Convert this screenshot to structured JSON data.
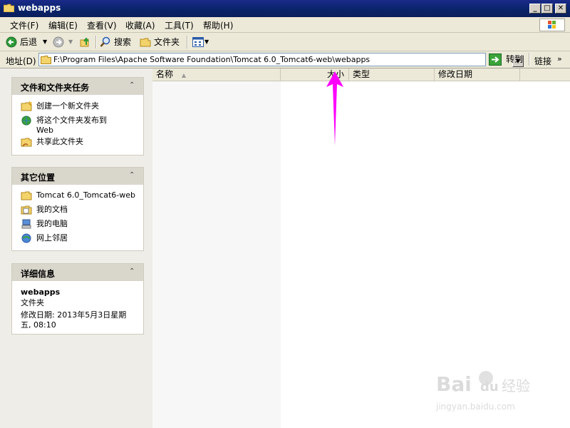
{
  "window": {
    "title": "webapps",
    "min_label": "_",
    "max_label": "□",
    "close_label": "✕"
  },
  "menu": {
    "items": [
      "文件(F)",
      "编辑(E)",
      "查看(V)",
      "收藏(A)",
      "工具(T)",
      "帮助(H)"
    ]
  },
  "toolbar": {
    "back_label": "后退",
    "search_label": "搜索",
    "folders_label": "文件夹"
  },
  "address": {
    "label": "地址(D)",
    "path": "F:\\Program Files\\Apache Software Foundation\\Tomcat 6.0_Tomcat6-web\\webapps",
    "go_label": "转到",
    "links_label": "链接"
  },
  "tasks": {
    "title": "文件和文件夹任务",
    "items": [
      "创建一个新文件夹",
      "将这个文件夹发布到",
      "Web",
      "共享此文件夹"
    ]
  },
  "other_places": {
    "title": "其它位置",
    "items": [
      "Tomcat 6.0_Tomcat6-web",
      "我的文档",
      "我的电脑",
      "网上邻居"
    ]
  },
  "details": {
    "title": "详细信息",
    "name": "webapps",
    "type": "文件夹",
    "modified_line1": "修改日期: 2013年5月3日星期",
    "modified_line2": "五, 08:10"
  },
  "columns": [
    "名称",
    "大小",
    "类型",
    "修改日期"
  ],
  "annotation": {
    "arrow_color": "#ff00ff"
  },
  "watermark": {
    "brand": "Bai",
    "brand2": "du",
    "cn": "经验",
    "url": "jingyan.baidu.com"
  }
}
